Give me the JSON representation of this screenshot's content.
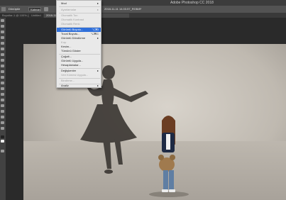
{
  "app": {
    "title": "Adobe Photoshop CC 2018"
  },
  "options_bar": {
    "tool": "Dönüştür",
    "field_1": "Katman",
    "field_2": "2018-11-11 14.03.57_RGB/8*"
  },
  "tabs": [
    {
      "label": "Boyutlar-1 @ 100% (Katman 4, RGB/8)"
    },
    {
      "label": "Untitled"
    },
    {
      "label": "2018-11-11 14.03.57.jpg @ 50% (RGB/8*)"
    }
  ],
  "menu": {
    "items": [
      {
        "label": "Mod",
        "submenu": true,
        "disabled": false
      },
      {
        "label": "Ayarlamalar",
        "submenu": true,
        "disabled": true
      },
      {
        "label": "Otomatik Ton",
        "disabled": true
      },
      {
        "label": "Otomatik Kontrast",
        "disabled": true
      },
      {
        "label": "Otomatik Renk",
        "disabled": true
      },
      {
        "label": "Görüntü Boyutu...",
        "shortcut": "⌥⌘I",
        "selected": true
      },
      {
        "label": "Tuval Boyutu...",
        "shortcut": "⌥⌘C"
      },
      {
        "label": "Görüntü Döndürme",
        "submenu": true
      },
      {
        "label": "Kırp",
        "disabled": true
      },
      {
        "label": "Kesim..."
      },
      {
        "label": "Tümünü Göster"
      },
      {
        "label": "Çoğalt..."
      },
      {
        "label": "Görüntü Uygula..."
      },
      {
        "label": "Hesaplamalar..."
      },
      {
        "label": "Değişkenler",
        "submenu": true
      },
      {
        "label": "Veri Kümesi Uygula...",
        "disabled": true
      },
      {
        "label": "Bindirme...",
        "disabled": true
      },
      {
        "label": "Analiz",
        "submenu": true
      }
    ]
  },
  "colors": {
    "menu_highlight": "#2f6fd9",
    "canvas_wall": "#cfc9c1",
    "shadow": "#3b3733"
  }
}
